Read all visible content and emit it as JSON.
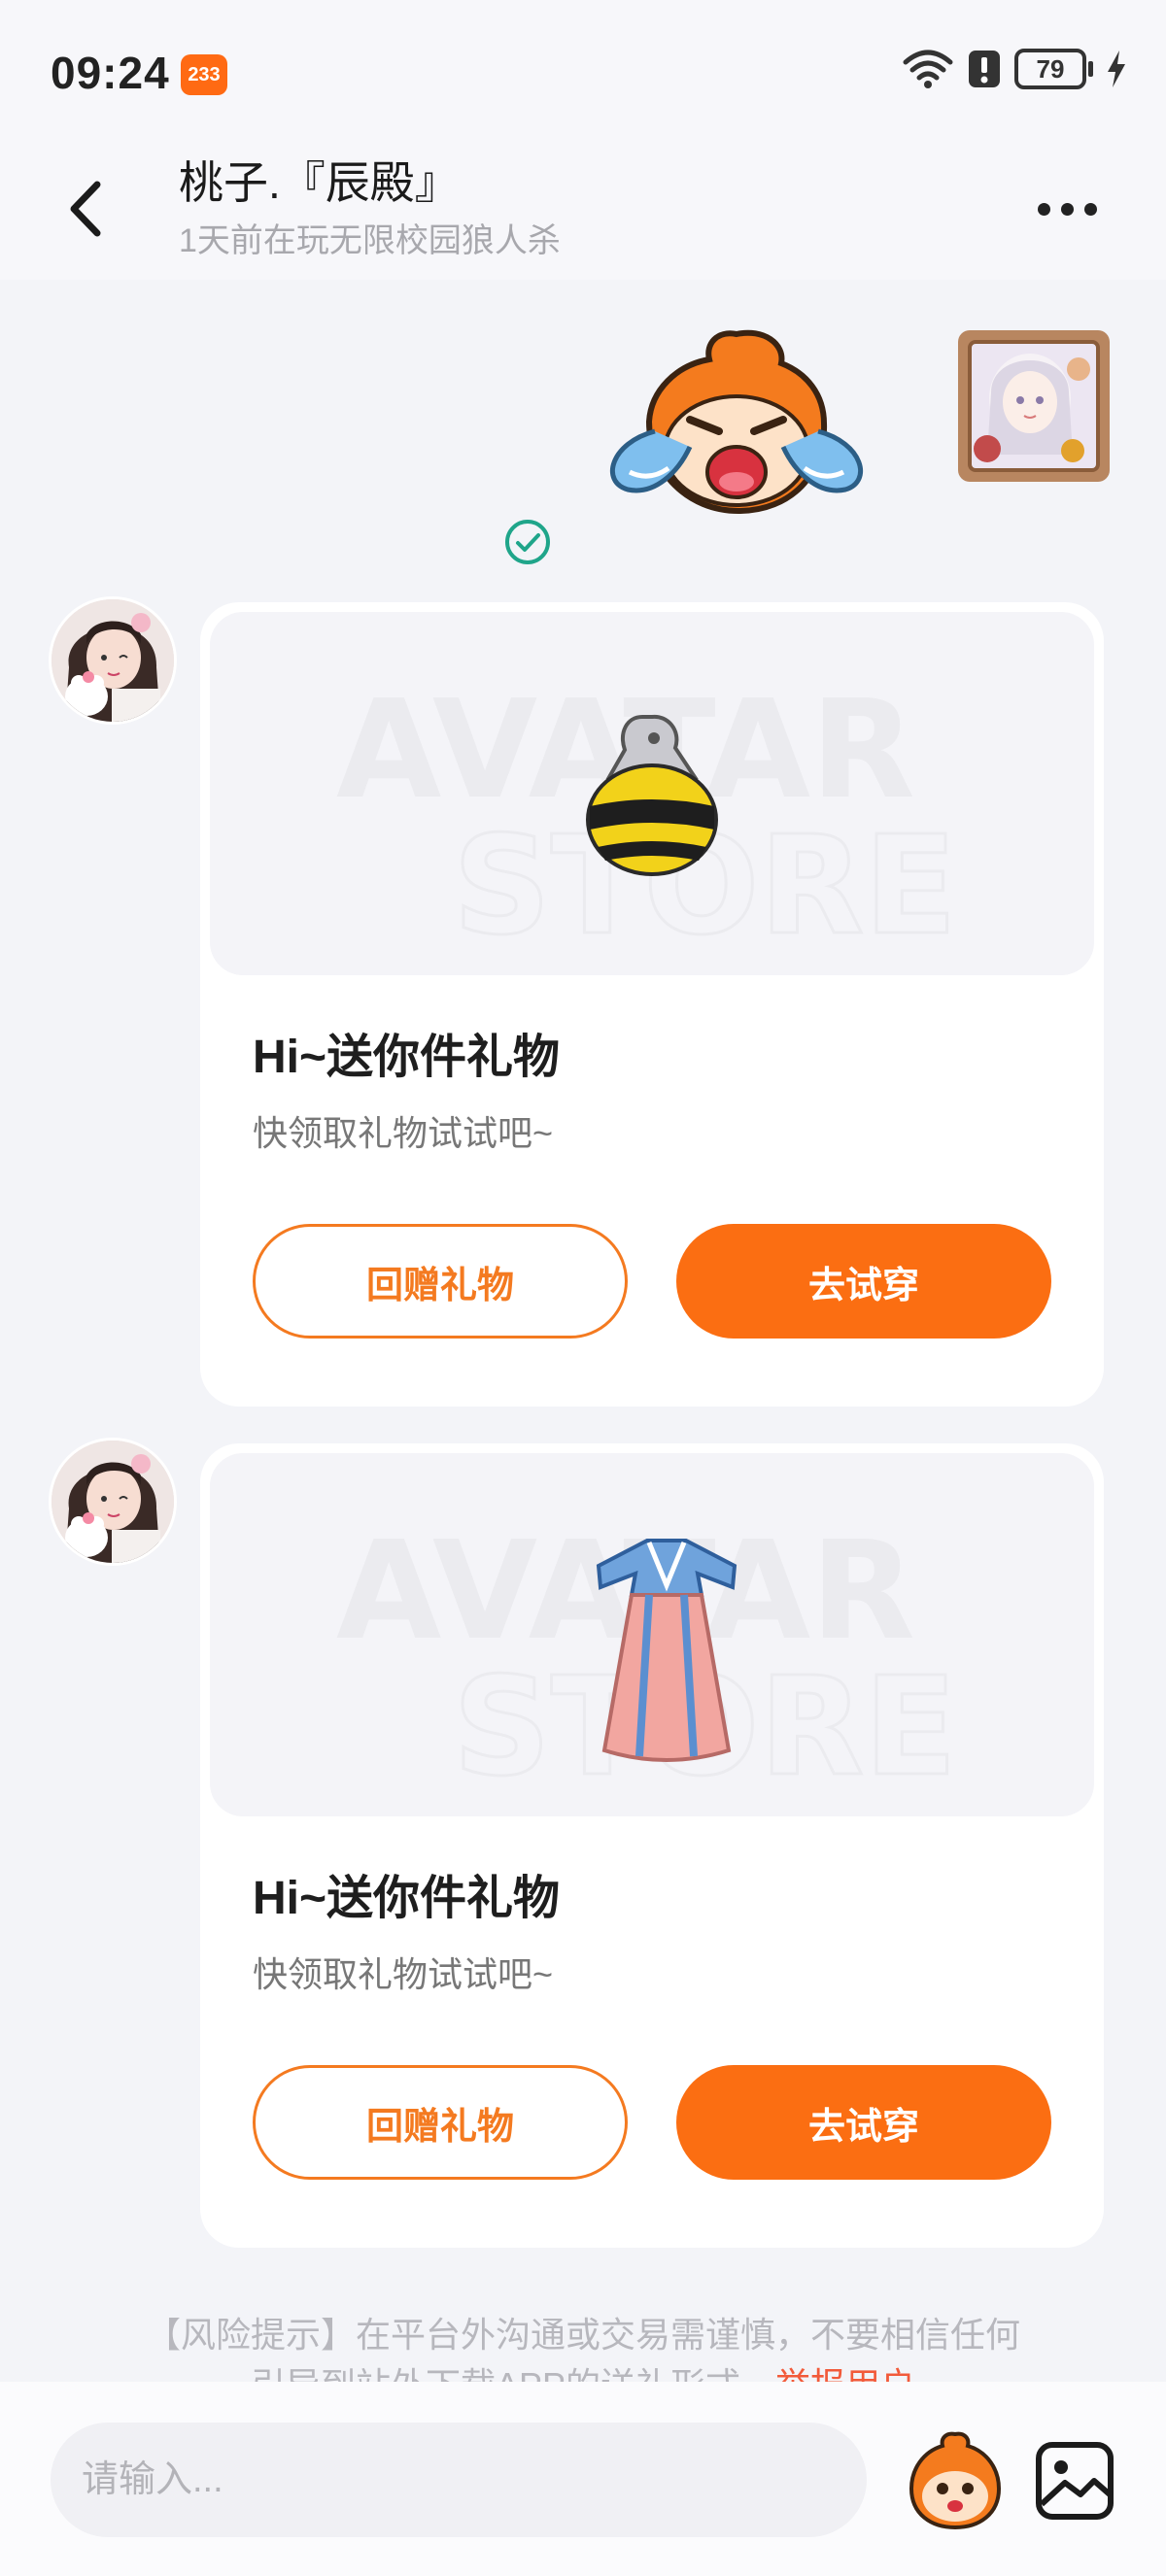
{
  "status_bar": {
    "time": "09:24",
    "app_badge": "233",
    "battery": "79"
  },
  "header": {
    "title": "桃子.『辰殿』",
    "subtitle": "1天前在玩无限校园狼人杀"
  },
  "messages": [
    {
      "type": "gift",
      "title": "Hi~送你件礼物",
      "subtitle": "快领取礼物试试吧~",
      "item_icon": "bee-bag-icon",
      "secondary_button": "回赠礼物",
      "primary_button": "去试穿"
    },
    {
      "type": "gift",
      "title": "Hi~送你件礼物",
      "subtitle": "快领取礼物试试吧~",
      "item_icon": "hanfu-dress-icon",
      "secondary_button": "回赠礼物",
      "primary_button": "去试穿"
    }
  ],
  "risk_notice": {
    "line1": "【风险提示】在平台外沟通或交易需谨慎，不要相信任何",
    "line2": "引导到站外下载APP的送礼形式，",
    "report_link": "举报用户"
  },
  "input": {
    "placeholder": "请输入..."
  },
  "colors": {
    "accent": "#fb6e12",
    "sent_check": "#1fa58a",
    "background": "#f3f4f8"
  }
}
